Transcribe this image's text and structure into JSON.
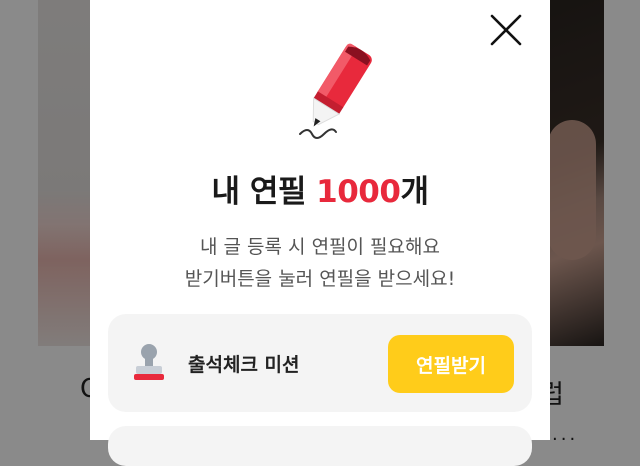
{
  "background": {
    "caption_left": "O",
    "caption_right": "럽",
    "dots": "..."
  },
  "modal": {
    "close_icon": "close-icon",
    "illustration_icon": "red-pencil-icon",
    "title_prefix": "내 연필 ",
    "title_count": "1000",
    "title_suffix": "개",
    "description_line1": "내 글 등록 시 연필이 필요해요",
    "description_line2": "받기버튼을 눌러 연필을 받으세요!",
    "mission": {
      "icon": "stamp-icon",
      "label": "출석체크 미션",
      "button_label": "연필받기"
    }
  },
  "colors": {
    "accent_red": "#e8293c",
    "button_yellow": "#ffcc1a",
    "card_bg": "#f4f4f4"
  }
}
